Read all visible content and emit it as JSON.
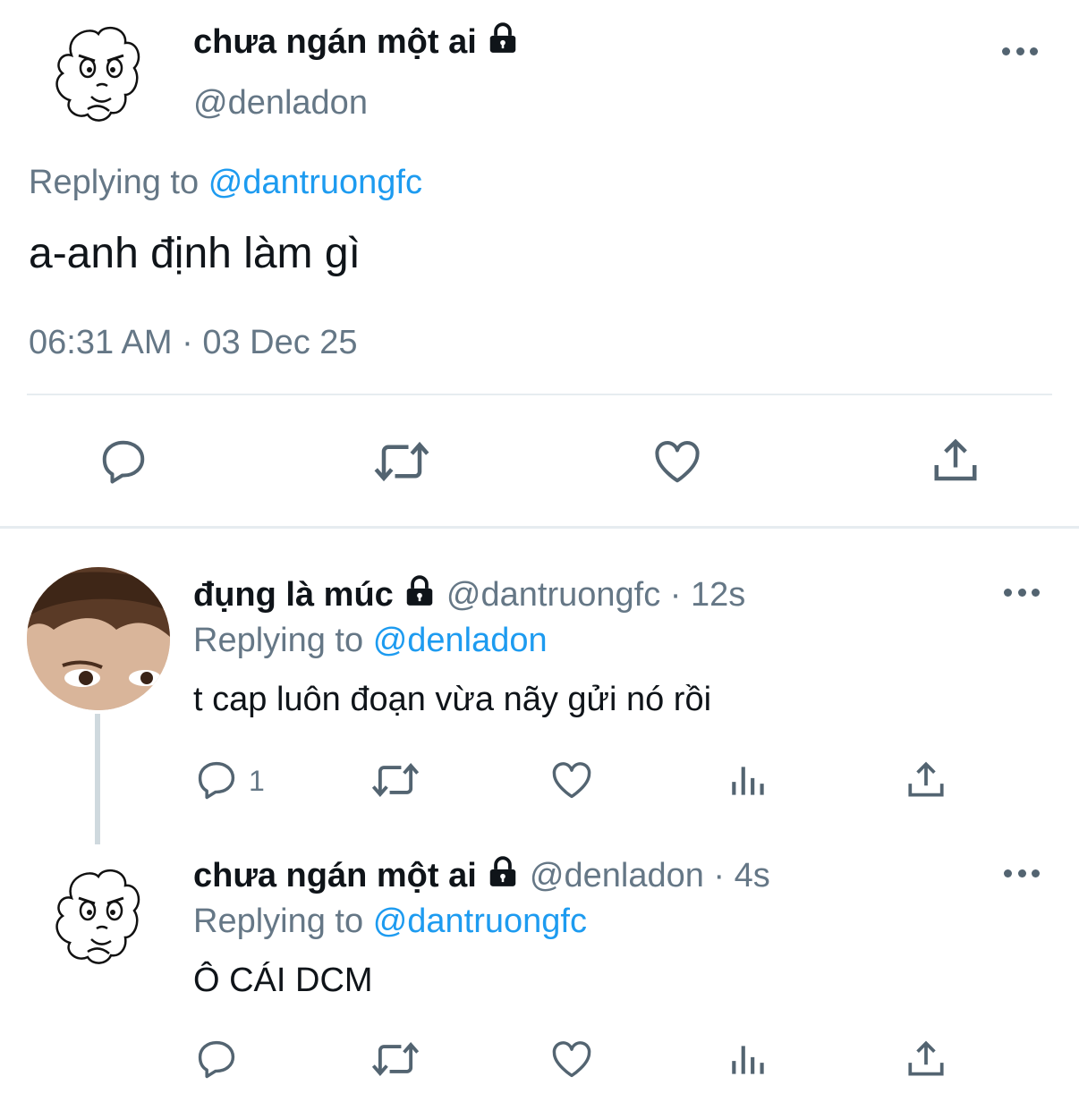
{
  "main_tweet": {
    "display_name": "chưa ngán một ai",
    "handle": "@denladon",
    "replying_prefix": "Replying to",
    "replying_to": "@dantruongfc",
    "text": "a-anh định làm gì",
    "timestamp": "06:31 AM · 03 Dec 25",
    "actions": [
      "reply-icon",
      "retweet-icon",
      "like-icon",
      "share-icon"
    ]
  },
  "reply_1": {
    "display_name": "đụng là múc",
    "meta": "@dantruongfc · 12s",
    "replying_prefix": "Replying to",
    "replying_to": "@denladon",
    "text": "t cap luôn đoạn vừa nãy gửi nó rồi",
    "reply_count": "1",
    "actions": [
      "reply-icon",
      "retweet-icon",
      "like-icon",
      "analytics-icon",
      "share-icon"
    ]
  },
  "reply_2": {
    "display_name": "chưa ngán một ai",
    "meta": "@denladon · 4s",
    "replying_prefix": "Replying to",
    "replying_to": "@dantruongfc",
    "text": "Ô CÁI DCM",
    "actions": [
      "reply-icon",
      "retweet-icon",
      "like-icon",
      "analytics-icon",
      "share-icon"
    ]
  },
  "colors": {
    "accent": "#1d9bf0",
    "secondary_text": "#657786",
    "divider": "#e6ecf0"
  }
}
